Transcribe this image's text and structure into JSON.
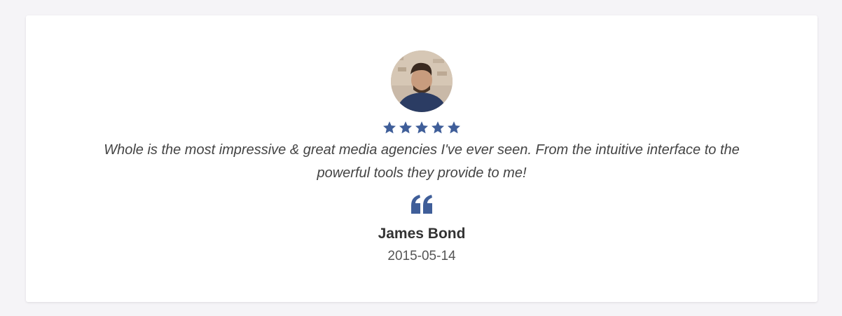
{
  "testimonial": {
    "avatar_icon": "person-photo-avatar",
    "rating": 5,
    "rating_max": 5,
    "star_color": "#3f5e99",
    "quote": "Whole is the most impressive & great media agencies I've ever seen. From the intuitive interface to the powerful tools they provide to me!",
    "quote_icon": "quote-left-icon",
    "author": "James Bond",
    "date": "2015-05-14"
  }
}
